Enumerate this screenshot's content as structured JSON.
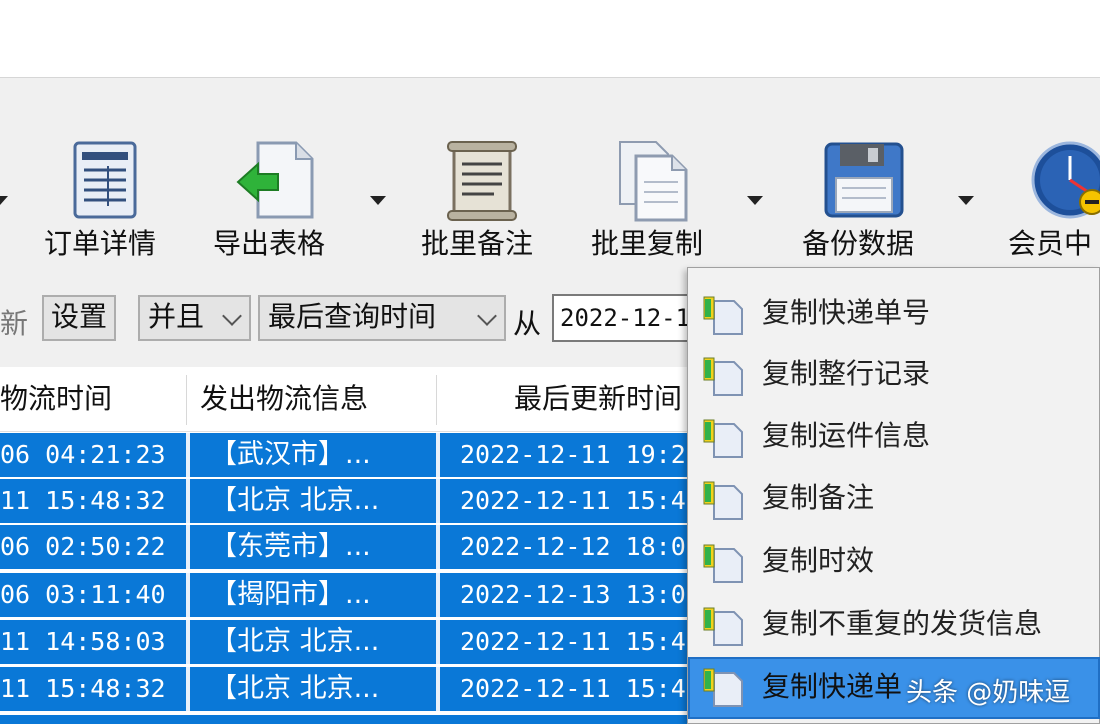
{
  "toolbar": {
    "buttons": [
      {
        "label": "订单详情"
      },
      {
        "label": "导出表格"
      },
      {
        "label": "批里备注"
      },
      {
        "label": "批里复制"
      },
      {
        "label": "备份数据"
      },
      {
        "label": "会员中"
      }
    ]
  },
  "filter": {
    "partial_left": "新",
    "settings": "设置",
    "logic": "并且",
    "field": "最后查询时间",
    "from_label": "从",
    "date_value": "2022-12-1"
  },
  "grid": {
    "columns": [
      "物流时间",
      "发出物流信息",
      "最后更新时间"
    ],
    "rows": [
      {
        "time": "06 04:21:23",
        "info": "【武汉市】...",
        "updated": "2022-12-11 19:2"
      },
      {
        "time": "11 15:48:32",
        "info": "【北京 北京...",
        "updated": "2022-12-11 15:4"
      },
      {
        "time": "06 02:50:22",
        "info": "【东莞市】...",
        "updated": "2022-12-12 18:0"
      },
      {
        "time": "06 03:11:40",
        "info": "【揭阳市】...",
        "updated": "2022-12-13 13:0"
      },
      {
        "time": "11 14:58:03",
        "info": "【北京 北京...",
        "updated": "2022-12-11 15:4"
      },
      {
        "time": "11 15:48:32",
        "info": "【北京 北京...",
        "updated": "2022-12-11 15:4"
      }
    ]
  },
  "context_menu": {
    "items": [
      {
        "label": "复制快递单号"
      },
      {
        "label": "复制整行记录"
      },
      {
        "label": "复制运件信息"
      },
      {
        "label": "复制备注"
      },
      {
        "label": "复制时效"
      },
      {
        "label": "复制不重复的发货信息"
      },
      {
        "label": "复制快递单"
      }
    ]
  },
  "watermark": "头条 @奶味逗",
  "colors": {
    "selection": "#0a78d7",
    "menu_highlight": "#3a91e8"
  }
}
